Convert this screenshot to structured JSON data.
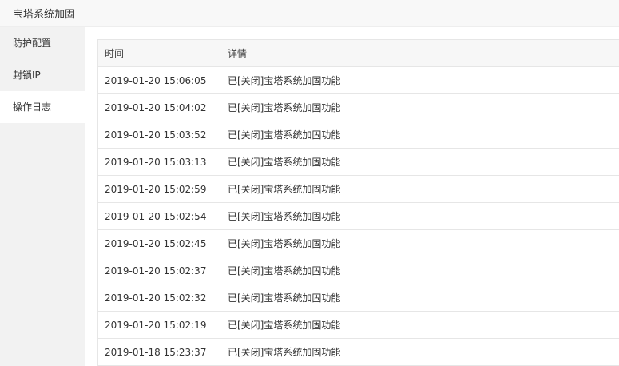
{
  "window": {
    "title": "宝塔系统加固"
  },
  "sidebar": {
    "items": [
      {
        "label": "防护配置"
      },
      {
        "label": "封锁IP"
      },
      {
        "label": "操作日志"
      }
    ]
  },
  "table": {
    "columns": [
      "时间",
      "详情"
    ],
    "rows": [
      [
        "2019-01-20 15:06:05",
        "已[关闭]宝塔系统加固功能"
      ],
      [
        "2019-01-20 15:04:02",
        "已[关闭]宝塔系统加固功能"
      ],
      [
        "2019-01-20 15:03:52",
        "已[关闭]宝塔系统加固功能"
      ],
      [
        "2019-01-20 15:03:13",
        "已[关闭]宝塔系统加固功能"
      ],
      [
        "2019-01-20 15:02:59",
        "已[关闭]宝塔系统加固功能"
      ],
      [
        "2019-01-20 15:02:54",
        "已[关闭]宝塔系统加固功能"
      ],
      [
        "2019-01-20 15:02:45",
        "已[关闭]宝塔系统加固功能"
      ],
      [
        "2019-01-20 15:02:37",
        "已[关闭]宝塔系统加固功能"
      ],
      [
        "2019-01-20 15:02:32",
        "已[关闭]宝塔系统加固功能"
      ],
      [
        "2019-01-20 15:02:19",
        "已[关闭]宝塔系统加固功能"
      ],
      [
        "2019-01-18 15:23:37",
        "已[关闭]宝塔系统加固功能"
      ]
    ]
  }
}
